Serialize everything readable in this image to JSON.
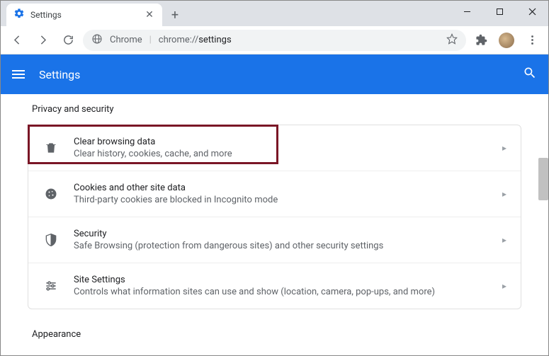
{
  "window": {
    "tab_title": "Settings"
  },
  "omnibox": {
    "scheme_label": "Chrome",
    "path_prefix": "chrome://",
    "path_main": "settings"
  },
  "header": {
    "title": "Settings"
  },
  "section": {
    "label": "Privacy and security"
  },
  "rows": {
    "clear": {
      "title": "Clear browsing data",
      "desc": "Clear history, cookies, cache, and more"
    },
    "cookies": {
      "title": "Cookies and other site data",
      "desc": "Third-party cookies are blocked in Incognito mode"
    },
    "security": {
      "title": "Security",
      "desc": "Safe Browsing (protection from dangerous sites) and other security settings"
    },
    "site": {
      "title": "Site Settings",
      "desc": "Controls what information sites can use and show (location, camera, pop-ups, and more)"
    }
  },
  "next_section": {
    "label": "Appearance"
  }
}
